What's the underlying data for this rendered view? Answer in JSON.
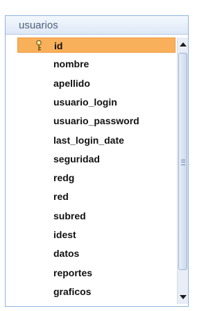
{
  "window": {
    "title": "usuarios"
  },
  "fields": [
    {
      "name": "id",
      "primary_key": true,
      "selected": true
    },
    {
      "name": "nombre"
    },
    {
      "name": "apellido"
    },
    {
      "name": "usuario_login"
    },
    {
      "name": "usuario_password"
    },
    {
      "name": "last_login_date"
    },
    {
      "name": "seguridad"
    },
    {
      "name": "redg"
    },
    {
      "name": "red"
    },
    {
      "name": "subred"
    },
    {
      "name": "idest"
    },
    {
      "name": "datos"
    },
    {
      "name": "reportes"
    },
    {
      "name": "graficos"
    }
  ],
  "scrollbar": {
    "position": 0.0,
    "visible_fraction": 0.92
  },
  "colors": {
    "selection": "#f9b05b",
    "border": "#8fb3dd",
    "title_text": "#4d607a"
  }
}
